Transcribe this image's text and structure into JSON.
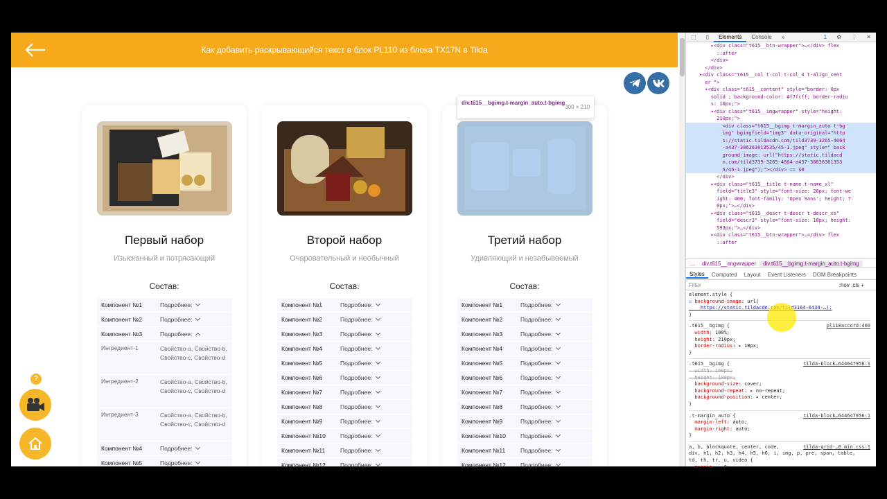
{
  "header": {
    "title": "Как добавить раскрывающийся текст в блок PL110 из блока TX17N в Tilda",
    "back_icon": "arrow-left-icon"
  },
  "social": [
    {
      "name": "telegram-icon",
      "label": "✈"
    },
    {
      "name": "vk-icon",
      "label": "vk"
    }
  ],
  "tooltip": {
    "selector": "div.t615__bgimg.t-margin_auto.t-bgimg",
    "size": "300 × 210"
  },
  "cards": [
    {
      "title": "Первый набор",
      "descr": "Изысканный и потрясающий",
      "comp": "Состав:",
      "rows_before": [
        {
          "name": "Компонент №1",
          "more": "Подробнее:"
        },
        {
          "name": "Компонент №2",
          "more": "Подробнее:"
        }
      ],
      "open": {
        "name": "Компонент №3",
        "more": "Подробнее:"
      },
      "ingredients": [
        {
          "name": "Ингредиент-1",
          "props": "Свойство-a, Свойство-b, Свойство-c, Свойство-d"
        },
        {
          "name": "Ингредиент-2",
          "props": "Свойство-a, Свойство-b, Свойство-c, Свойство-d"
        },
        {
          "name": "Ингредиент-3",
          "props": "Свойство-a, Свойство-b, Свойство-c, Свойство-d"
        }
      ],
      "rows_after": [
        {
          "name": "Компонент №4",
          "more": "Подробнее:"
        },
        {
          "name": "Компонент №5",
          "more": "Подробнее:"
        }
      ]
    },
    {
      "title": "Второй набор",
      "descr": "Очаровательный и необычный",
      "comp": "Состав:",
      "rows": [
        {
          "name": "Компонент №1",
          "more": "Подробнее:"
        },
        {
          "name": "Компонент №2",
          "more": "Подробнее:"
        },
        {
          "name": "Компонент №3",
          "more": "Подробнее:"
        },
        {
          "name": "Компонент №4",
          "more": "Подробнее:"
        },
        {
          "name": "Компонент №5",
          "more": "Подробнее:"
        },
        {
          "name": "Компонент №6",
          "more": "Подробнее:"
        },
        {
          "name": "Компонент №7",
          "more": "Подробнее:"
        },
        {
          "name": "Компонент №8",
          "more": "Подробнее:"
        },
        {
          "name": "Компонент №9",
          "more": "Подробнее:"
        },
        {
          "name": "Компонент №10",
          "more": "Подробнее:"
        },
        {
          "name": "Компонент №11",
          "more": "Подробнее:"
        },
        {
          "name": "Компонент №12",
          "more": "Подробнее:"
        }
      ]
    },
    {
      "title": "Третий набор",
      "descr": "Удивляющий и незабываемый",
      "comp": "Состав:",
      "rows": [
        {
          "name": "Компонент №1",
          "more": "Подробнее:"
        },
        {
          "name": "Компонент №2",
          "more": "Подробнее:"
        },
        {
          "name": "Компонент №3",
          "more": "Подробнее:"
        },
        {
          "name": "Компонент №4",
          "more": "Подробнее:"
        },
        {
          "name": "Компонент №5",
          "more": "Подробнее:"
        },
        {
          "name": "Компонент №6",
          "more": "Подробнее:"
        },
        {
          "name": "Компонент №7",
          "more": "Подробнее:"
        },
        {
          "name": "Компонент №8",
          "more": "Подробнее:"
        },
        {
          "name": "Компонент №9",
          "more": "Подробнее:"
        },
        {
          "name": "Компонент №10",
          "more": "Подробнее:"
        },
        {
          "name": "Компонент №11",
          "more": "Подробнее:"
        },
        {
          "name": "Компонент №12",
          "more": "Подробнее:"
        }
      ]
    }
  ],
  "floating": {
    "help": "?",
    "video_icon": "video-camera-icon",
    "home_icon": "home-icon"
  },
  "devtools": {
    "tabs": [
      "Elements",
      "Console"
    ],
    "badge": "1",
    "dom_lines": [
      "        ▸<div class=\"t615__btn-wrapper\">…</div> flex",
      "          ::after",
      "        </div>",
      "      </div>",
      "    ▾<div class=\"t615__col t-col t-col_4 t-align_cent",
      "      er \">",
      "      ▾<div class=\"t615__content\" style=\"border: 0px",
      "        solid ; background-color: #f7fcff; border-radiu",
      "        s: 10px;\">",
      "        ▾<div class=\"t615__imgwrapper\" style=\"height:",
      "          210px;\">",
      "            <div class=\"t615__bgimg t-margin_auto t-bg",
      "            img\" bgimgfield=\"img3\" data-original=\"http",
      "            s://static.tildacdn.com/tild3739-3265-4664",
      "            -a437-386363613535/45-1.jpeg\" style=\" back",
      "            ground-image: url(\"https://static.tildacd",
      "            n.com/tild3739-3265-4664-a437-38636361353",
      "            5/45-1.jpeg\");\"></div> == $0",
      "          </div>",
      "        ▸<div class=\"t615__title t-name t-name_xl\"",
      "          field=\"title3\" style=\"font-size: 26px; font-we",
      "          ight: 400; font-family: 'Open Sans'; height: 7",
      "          0px;\">…</div>",
      "        ▸<div class=\"t615__descr t-descr t-descr_xs\"",
      "          field=\"descr3\" style=\"font-size: 18px; height:",
      "          593px;\">…</div>",
      "        ▸<div class=\"t615__btn-wrapper\">…</div> flex",
      "          ::after"
    ],
    "crumbs": [
      "…",
      "div.t615__imgwrapper",
      "div.t615__bgimg.t-margin_auto.t-bgimg"
    ],
    "style_tabs": [
      "Styles",
      "Computed",
      "Layout",
      "Event Listeners",
      "DOM Breakpoints"
    ],
    "filter": "Filter",
    "filter_tools": ":hov  .cls  +",
    "styles": [
      {
        "t": "sel",
        "v": "element.style {"
      },
      {
        "t": "prop",
        "n": "background-image",
        "v": ": url("
      },
      {
        "t": "url",
        "v": "    https://static.tildacdn.com/tild3164-6434-…);"
      },
      {
        "t": "sel",
        "v": "}"
      },
      {
        "t": "div"
      },
      {
        "t": "selsrc",
        "v": ".t615__bgimg {",
        "s": "pl110accord:460"
      },
      {
        "t": "prop",
        "n": "  width",
        "v": ": 100%;"
      },
      {
        "t": "prop",
        "n": "  height",
        "v": ": 210px;"
      },
      {
        "t": "prop",
        "n": "  border-radius",
        "v": ": ▸ 10px;"
      },
      {
        "t": "sel",
        "v": "}"
      },
      {
        "t": "div"
      },
      {
        "t": "selsrc",
        "v": ".t615__bgimg {",
        "s": "tilda-block…644647956:1"
      },
      {
        "t": "strike",
        "n": "  width",
        "v": ": 100px;"
      },
      {
        "t": "strike",
        "n": "  height",
        "v": ": 100px;"
      },
      {
        "t": "prop",
        "n": "  background-size",
        "v": ": cover;"
      },
      {
        "t": "prop",
        "n": "  background-repeat",
        "v": ": ▸ no-repeat;"
      },
      {
        "t": "prop",
        "n": "  background-position",
        "v": ": ▸ center;"
      },
      {
        "t": "sel",
        "v": "}"
      },
      {
        "t": "div"
      },
      {
        "t": "selsrc",
        "v": ".t-margin_auto {",
        "s": "tilda-block…644647956:1"
      },
      {
        "t": "prop",
        "n": "  margin-left",
        "v": ": auto;"
      },
      {
        "t": "prop",
        "n": "  margin-right",
        "v": ": auto;"
      },
      {
        "t": "sel",
        "v": "}"
      },
      {
        "t": "div"
      },
      {
        "t": "selsrc",
        "v": "a, b, blockquote, center, code,",
        "s": "tilda-grid-…0.min.css:1"
      },
      {
        "t": "sel",
        "v": "div, h1, h2, h3, h4, h5, h6, i, img, p, pre, span, table,"
      },
      {
        "t": "sel",
        "v": "td, th, tr, u, video {"
      },
      {
        "t": "prop",
        "n": "  margin",
        "v": ": ▸ 0;"
      }
    ]
  }
}
